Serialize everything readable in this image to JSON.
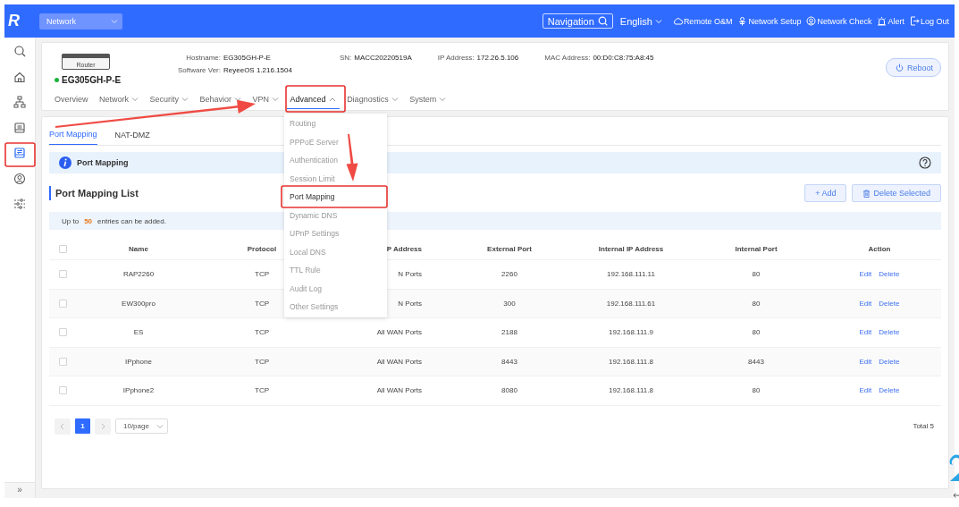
{
  "topbar": {
    "logo": "R",
    "network_select": "Network",
    "navigation": "Navigation",
    "language": "English",
    "links": [
      {
        "kind": "cloud",
        "label": "Remote O&M"
      },
      {
        "kind": "setup",
        "label": "Network Setup"
      },
      {
        "kind": "check",
        "label": "Network Check"
      },
      {
        "kind": "alert",
        "label": "Alert"
      },
      {
        "kind": "logout",
        "label": "Log Out"
      }
    ]
  },
  "sidebar": {
    "items": [
      {
        "kind": "search",
        "selected": false
      },
      {
        "kind": "home",
        "selected": false
      },
      {
        "kind": "topology",
        "selected": false
      },
      {
        "kind": "device",
        "selected": false
      },
      {
        "kind": "mapping",
        "selected": true
      },
      {
        "kind": "user",
        "selected": false
      },
      {
        "kind": "sliders",
        "selected": false
      }
    ],
    "expand": "»"
  },
  "device": {
    "image_label": "Router",
    "name": "EG305GH-P-E",
    "online": true,
    "fields": [
      {
        "label": "Hostname:",
        "value": "EG305GH-P-E"
      },
      {
        "label": "Software Ver:",
        "value": "ReyeeOS 1.216.1504"
      },
      {
        "label": "SN:",
        "value": "MACC20220519A"
      },
      {
        "label": "IP Address:",
        "value": "172.26.5.106"
      },
      {
        "label": "MAC Address:",
        "value": "00:D0:C8:75:A8:45"
      }
    ],
    "reboot": "Reboot"
  },
  "nav_tabs": [
    {
      "label": "Overview",
      "has_menu": false,
      "selected": false
    },
    {
      "label": "Network",
      "has_menu": true,
      "selected": false
    },
    {
      "label": "Security",
      "has_menu": true,
      "selected": false
    },
    {
      "label": "Behavior",
      "has_menu": true,
      "selected": false
    },
    {
      "label": "VPN",
      "has_menu": true,
      "selected": false
    },
    {
      "label": "Advanced",
      "has_menu": true,
      "selected": true
    },
    {
      "label": "Diagnostics",
      "has_menu": true,
      "selected": false
    },
    {
      "label": "System",
      "has_menu": true,
      "selected": false
    }
  ],
  "advanced_menu": [
    {
      "label": "Routing",
      "selected": false
    },
    {
      "label": "PPPoE Server",
      "selected": false
    },
    {
      "label": "Authentication",
      "selected": false
    },
    {
      "label": "Session Limit",
      "selected": false
    },
    {
      "label": "Port Mapping",
      "selected": true
    },
    {
      "label": "Dynamic DNS",
      "selected": false
    },
    {
      "label": "UPnP Settings",
      "selected": false
    },
    {
      "label": "Local DNS",
      "selected": false
    },
    {
      "label": "TTL Rule",
      "selected": false
    },
    {
      "label": "Audit Log",
      "selected": false
    },
    {
      "label": "Other Settings",
      "selected": false
    }
  ],
  "sub_tabs": [
    {
      "label": "Port Mapping",
      "selected": true
    },
    {
      "label": "NAT-DMZ",
      "selected": false
    }
  ],
  "info_bar": {
    "title": "Port Mapping"
  },
  "list": {
    "title": "Port Mapping List",
    "add": "+ Add",
    "delete_selected": "Delete Selected",
    "note": {
      "before": "Up to",
      "count": "50",
      "after": "entries can be added."
    }
  },
  "table": {
    "select_all_checked": false,
    "columns": [
      "Name",
      "Protocol",
      "P Address",
      "External Port",
      "Internal IP Address",
      "Internal Port",
      "Action"
    ],
    "rows": [
      {
        "checked": false,
        "cells": [
          "RAP2260",
          "TCP",
          "N Ports",
          "2260",
          "192.168.111.11",
          "80"
        ],
        "actions": [
          "Edit",
          "Delete"
        ]
      },
      {
        "checked": false,
        "cells": [
          "EW300pro",
          "TCP",
          "N Ports",
          "300",
          "192.168.111.61",
          "80"
        ],
        "actions": [
          "Edit",
          "Delete"
        ]
      },
      {
        "checked": false,
        "cells": [
          "ES",
          "TCP",
          "All WAN Ports",
          "2188",
          "192.168.111.9",
          "80"
        ],
        "actions": [
          "Edit",
          "Delete"
        ]
      },
      {
        "checked": false,
        "cells": [
          "IPphone",
          "TCP",
          "All WAN Ports",
          "8443",
          "192.168.111.8",
          "8443"
        ],
        "actions": [
          "Edit",
          "Delete"
        ]
      },
      {
        "checked": false,
        "cells": [
          "IPphone2",
          "TCP",
          "All WAN Ports",
          "8080",
          "192.168.111.8",
          "80"
        ],
        "actions": [
          "Edit",
          "Delete"
        ]
      }
    ]
  },
  "pagination": {
    "pages": [
      {
        "label": "1",
        "selected": true
      }
    ],
    "page_size": "10/page",
    "total": "Total 5"
  }
}
